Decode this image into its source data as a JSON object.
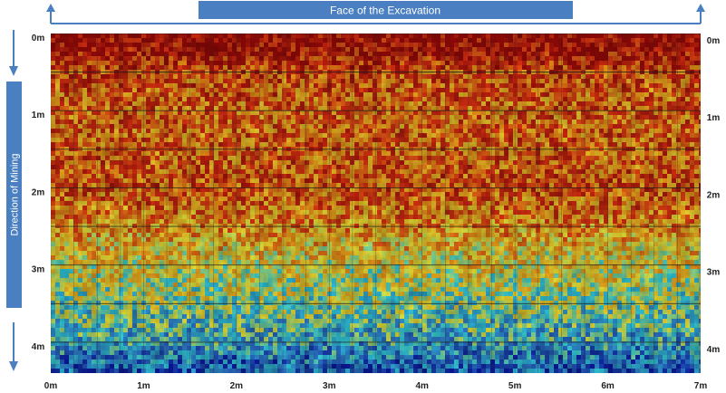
{
  "chart_data": {
    "type": "heatmap",
    "title": "Face of the Excavation",
    "ylabel": "Direction of Mining",
    "x_ticks": [
      "0m",
      "1m",
      "2m",
      "3m",
      "4m",
      "5m",
      "6m",
      "7m"
    ],
    "y_ticks_left": [
      "0m",
      "1m",
      "2m",
      "3m",
      "4m"
    ],
    "y_ticks_right": [
      "0m",
      "1m",
      "2m",
      "3m",
      "4m"
    ],
    "xlim": [
      0,
      7
    ],
    "ylim": [
      0,
      4.4
    ],
    "y_axis_inverted": true,
    "grid": true,
    "colormap": [
      "#0a1aa8",
      "#2f7fd6",
      "#33d6e6",
      "#f5f03a",
      "#f5a21a",
      "#e63312",
      "#9e0a08"
    ],
    "profile": {
      "depth_m": [
        0.0,
        0.25,
        0.5,
        1.0,
        1.5,
        2.0,
        2.5,
        3.0,
        3.5,
        4.0,
        4.4
      ],
      "intensity": [
        0.98,
        0.93,
        0.8,
        0.74,
        0.75,
        0.78,
        0.66,
        0.52,
        0.42,
        0.28,
        0.12
      ]
    }
  },
  "colors": {
    "title_bar": "#4a7fc1",
    "title_text": "#ffffff",
    "arrow": "#4a7fc1"
  }
}
